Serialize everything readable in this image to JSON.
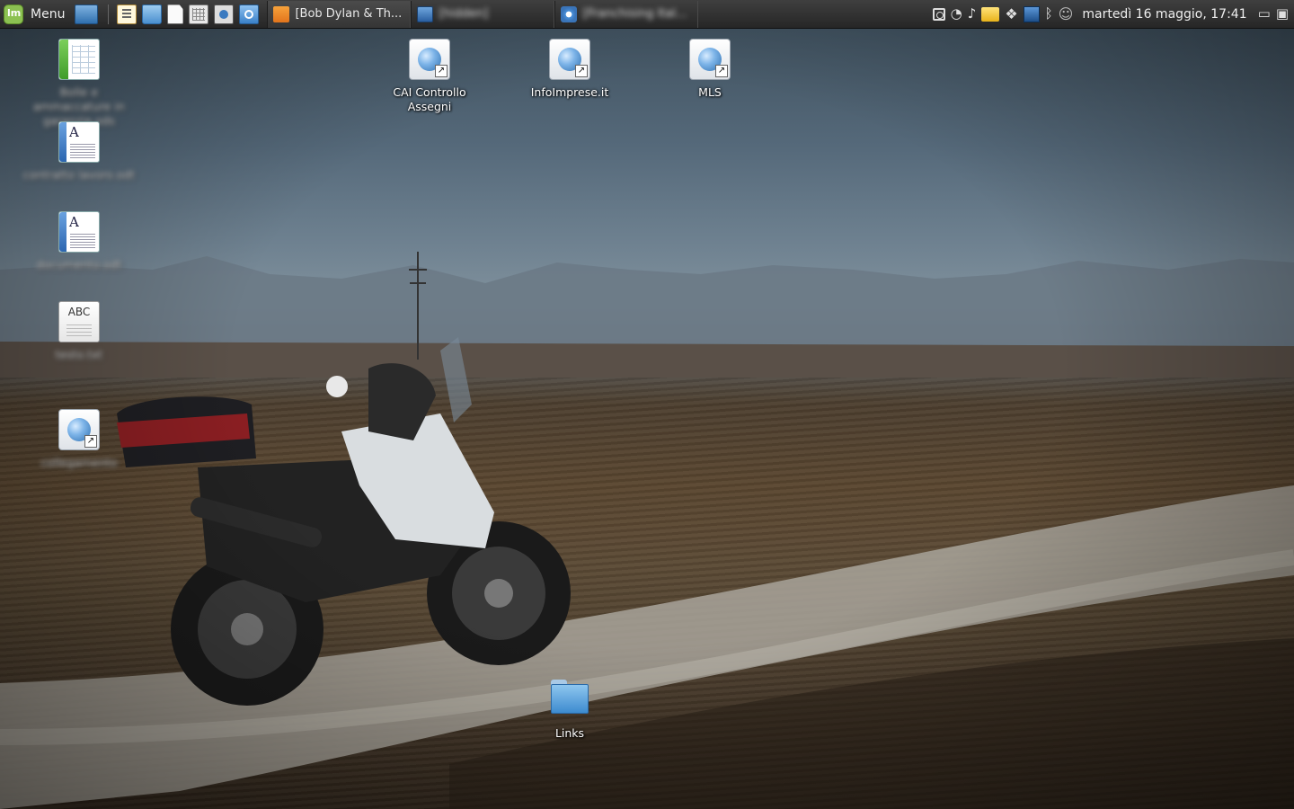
{
  "panel": {
    "menu_label": "Menu",
    "launchers": [
      "show-desktop-icon",
      "text-editor-icon",
      "files-icon",
      "document-icon",
      "calculator-icon",
      "screenshot-icon",
      "browser-icon"
    ],
    "tasks": [
      {
        "label": "[Bob Dylan & Th...",
        "icon": "rss-icon",
        "active": true
      },
      {
        "label": "[hidden]",
        "icon": "window-icon",
        "active": false,
        "blurred": true
      },
      {
        "label": "[Franchising Ital...",
        "icon": "chromium-icon",
        "active": false,
        "blurred": true
      }
    ],
    "clock": "martedì 16 maggio, 17:41",
    "tray_icons": [
      "screenshot-tray-icon",
      "wifi-icon",
      "music-note-icon",
      "mail-icon",
      "dropbox-icon",
      "network-icon",
      "bluetooth-icon",
      "user-icon",
      "display-icon",
      "shutdown-icon"
    ]
  },
  "desktop": {
    "icons": [
      {
        "name": "spreadsheet-file",
        "label": "Bolle e ammaccature in garanzia.ods",
        "type": "spreadsheet",
        "blurred": true
      },
      {
        "name": "text-document-1",
        "label": "contratto lavoro.odt",
        "type": "text",
        "blurred": true
      },
      {
        "name": "text-document-2",
        "label": "documento.odt",
        "type": "text",
        "blurred": true
      },
      {
        "name": "abc-document",
        "label": "testo.txt",
        "type": "abc",
        "blurred": true
      },
      {
        "name": "web-link-blurred",
        "label": "collegamento",
        "type": "web",
        "blurred": true
      },
      {
        "name": "cai-controllo-assegni",
        "label": "CAI Controllo Assegni",
        "type": "web",
        "blurred": false
      },
      {
        "name": "infoimprese",
        "label": "InfoImprese.it",
        "type": "web",
        "blurred": false
      },
      {
        "name": "mls",
        "label": "MLS",
        "type": "web",
        "blurred": false
      },
      {
        "name": "links-folder",
        "label": "Links",
        "type": "folder",
        "blurred": false
      }
    ]
  },
  "colors": {
    "panel_bg": "#2f2f2f",
    "mint_green": "#8cc152",
    "label_text": "#ffffff"
  }
}
